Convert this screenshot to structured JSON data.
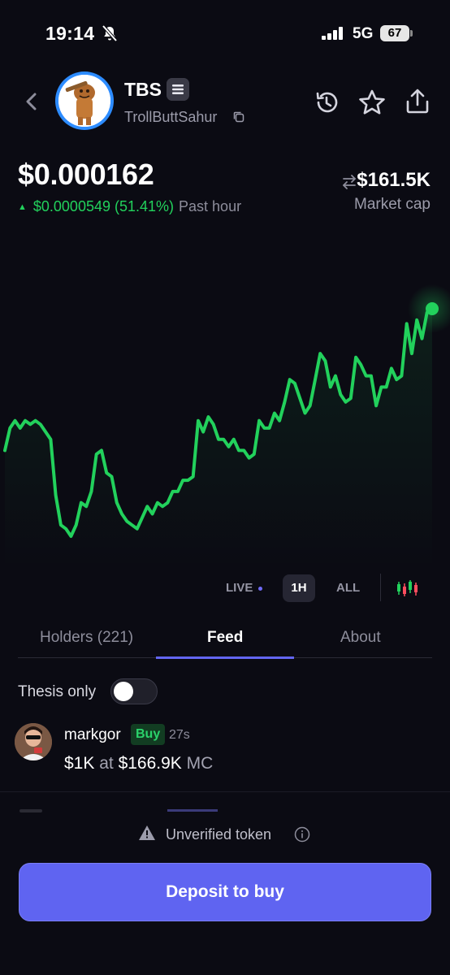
{
  "status_bar": {
    "time": "19:14",
    "network": "5G",
    "battery": "67"
  },
  "header": {
    "symbol": "TBS",
    "name": "TrollButtSahur",
    "icons": [
      "back-icon",
      "history-icon",
      "star-icon",
      "share-icon",
      "copy-icon"
    ]
  },
  "price": {
    "current": "$0.000162",
    "change": "$0.0000549 (51.41%)",
    "period": "Past hour",
    "market_cap": "$161.5K",
    "market_cap_label": "Market cap"
  },
  "chart_data": {
    "type": "line",
    "color": "#22d15c",
    "x_unit": "time (past hour)",
    "values": [
      0.000124,
      0.00013,
      0.000132,
      0.00013,
      0.000132,
      0.000131,
      0.000132,
      0.000131,
      0.000129,
      0.000127,
      0.000112,
      0.000104,
      0.000103,
      0.000101,
      0.000104,
      0.00011,
      0.000109,
      0.000113,
      0.000123,
      0.000124,
      0.000118,
      0.000117,
      0.00011,
      0.000107,
      0.000105,
      0.000104,
      0.000103,
      0.000106,
      0.000109,
      0.000107,
      0.00011,
      0.000109,
      0.00011,
      0.000113,
      0.000113,
      0.000116,
      0.000116,
      0.000117,
      0.000132,
      0.000129,
      0.000133,
      0.000131,
      0.000127,
      0.000127,
      0.000125,
      0.000127,
      0.000124,
      0.000124,
      0.000122,
      0.000123,
      0.000132,
      0.00013,
      0.00013,
      0.000134,
      0.000132,
      0.000137,
      0.000143,
      0.000142,
      0.000138,
      0.000134,
      0.000136,
      0.000143,
      0.00015,
      0.000148,
      0.000141,
      0.000144,
      0.000139,
      0.000137,
      0.000138,
      0.000149,
      0.000147,
      0.000144,
      0.000144,
      0.000136,
      0.000141,
      0.000141,
      0.000146,
      0.000143,
      0.000144,
      0.000158,
      0.00015,
      0.000159,
      0.000154,
      0.000161,
      0.000162
    ]
  },
  "range": {
    "live": "LIVE",
    "hour": "1H",
    "all": "ALL",
    "selected": "1H"
  },
  "tabs": {
    "holders": "Holders (221)",
    "feed": "Feed",
    "about": "About",
    "active": "Feed"
  },
  "filter": {
    "thesis_label": "Thesis only",
    "thesis_on": false
  },
  "feed": [
    {
      "user": "markgor",
      "action": "Buy",
      "time": "27s",
      "amount": "$1K",
      "at": "at",
      "mc": "$166.9K",
      "mc_suffix": "MC"
    }
  ],
  "footer": {
    "warning": "Unverified token",
    "button": "Deposit to buy"
  },
  "colors": {
    "background": "#0b0b13",
    "accent": "#5f64f1",
    "positive": "#22d15c"
  }
}
